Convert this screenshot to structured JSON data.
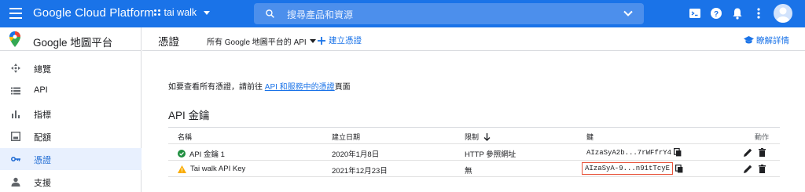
{
  "topbar": {
    "brand": "Google Cloud Platform",
    "project": "tai walk",
    "search_placeholder": "搜尋產品和資源",
    "icons": [
      "menu-icon",
      "search-icon",
      "terminal-icon",
      "help-icon",
      "bell-icon",
      "more-vert-icon",
      "account-icon"
    ],
    "bg": "#1a73e8"
  },
  "sidebar": {
    "product": "Google 地圖平台",
    "items": [
      {
        "label": "總覽",
        "icon": "overview-icon"
      },
      {
        "label": "API",
        "icon": "list-icon"
      },
      {
        "label": "指標",
        "icon": "bar-chart-icon"
      },
      {
        "label": "配額",
        "icon": "quota-icon"
      },
      {
        "label": "憑證",
        "icon": "key-icon",
        "active": true
      },
      {
        "label": "支援",
        "icon": "person-icon"
      }
    ]
  },
  "page": {
    "title": "憑證",
    "filter": "所有 Google 地圖平台的 API",
    "create": "建立憑證",
    "learn_more": "瞭解詳情",
    "info_prefix": "如要查看所有憑證，請前往 ",
    "info_link": "API 和服務中的憑證",
    "info_suffix": "頁面",
    "section_title": "API 金鑰"
  },
  "table": {
    "headers": {
      "name": "名稱",
      "date": "建立日期",
      "limit": "限制",
      "key": "鍵",
      "actions": "動作"
    },
    "rows": [
      {
        "name": "API 金鑰 1",
        "status": "ok",
        "date": "2020年1月8日",
        "limit": "HTTP 參照網址",
        "key": "AIzaSyA2b...7rWFfrY4"
      },
      {
        "name": "Tai walk API Key",
        "status": "warning",
        "date": "2021年12月23日",
        "limit": "無",
        "key": "AIzaSyA-9...n91tTcyE",
        "highlighted": true
      }
    ]
  },
  "colors": {
    "accent": "#1a73e8",
    "ok": "#1e8e3e",
    "warning": "#f9ab00",
    "highlight": "#e8543b"
  }
}
